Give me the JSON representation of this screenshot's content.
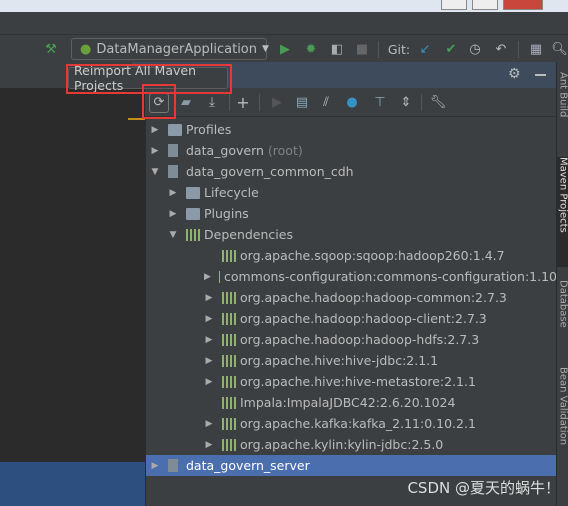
{
  "toolbar": {
    "run_config": "DataManagerApplication",
    "git_label": "Git:"
  },
  "tooltip": "Reimport All Maven Projects",
  "tree": [
    {
      "label": "Profiles",
      "level": 0,
      "arrow": "right",
      "icon": "folder"
    },
    {
      "label": "data_govern",
      "suffix": "(root)",
      "level": 0,
      "arrow": "right",
      "icon": "module"
    },
    {
      "label": "data_govern_common_cdh",
      "level": 0,
      "arrow": "down",
      "icon": "module"
    },
    {
      "label": "Lifecycle",
      "level": 1,
      "arrow": "right",
      "icon": "folder"
    },
    {
      "label": "Plugins",
      "level": 1,
      "arrow": "right",
      "icon": "folder"
    },
    {
      "label": "Dependencies",
      "level": 1,
      "arrow": "down",
      "icon": "deps"
    },
    {
      "label": "org.apache.sqoop:sqoop:hadoop260:1.4.7",
      "level": 2,
      "arrow": "",
      "icon": "lib"
    },
    {
      "label": "commons-configuration:commons-configuration:1.10",
      "level": 2,
      "arrow": "right",
      "icon": "lib"
    },
    {
      "label": "org.apache.hadoop:hadoop-common:2.7.3",
      "level": 2,
      "arrow": "right",
      "icon": "lib"
    },
    {
      "label": "org.apache.hadoop:hadoop-client:2.7.3",
      "level": 2,
      "arrow": "right",
      "icon": "lib"
    },
    {
      "label": "org.apache.hadoop:hadoop-hdfs:2.7.3",
      "level": 2,
      "arrow": "right",
      "icon": "lib"
    },
    {
      "label": "org.apache.hive:hive-jdbc:2.1.1",
      "level": 2,
      "arrow": "right",
      "icon": "lib"
    },
    {
      "label": "org.apache.hive:hive-metastore:2.1.1",
      "level": 2,
      "arrow": "right",
      "icon": "lib"
    },
    {
      "label": "Impala:ImpalaJDBC42:2.6.20.1024",
      "level": 2,
      "arrow": "",
      "icon": "lib"
    },
    {
      "label": "org.apache.kafka:kafka_2.11:0.10.2.1",
      "level": 2,
      "arrow": "right",
      "icon": "lib"
    },
    {
      "label": "org.apache.kylin:kylin-jdbc:2.5.0",
      "level": 2,
      "arrow": "right",
      "icon": "lib"
    },
    {
      "label": "data_govern_server",
      "level": 0,
      "arrow": "right",
      "icon": "module",
      "selected": true
    }
  ],
  "side_tabs": [
    "Ant Build",
    "Maven Projects",
    "Database",
    "Bean Validation"
  ],
  "watermark": "CSDN @夏天的蜗牛！"
}
